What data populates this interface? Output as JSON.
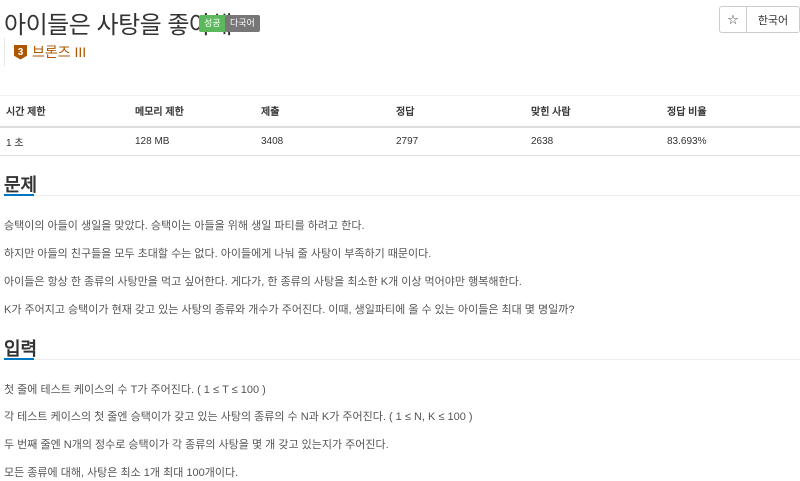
{
  "problem": {
    "title": "아이들은 사탕을 좋아해",
    "badges": [
      "성공",
      "다국어"
    ],
    "tier": {
      "icon_number": "3",
      "label": "브론즈 III",
      "color": "#ad5600"
    }
  },
  "toolbar": {
    "star_icon": "star-icon",
    "star_glyph": "☆",
    "language_label": "한국어"
  },
  "stats": {
    "headers": [
      "시간 제한",
      "메모리 제한",
      "제출",
      "정답",
      "맞힌 사람",
      "정답 비율"
    ],
    "values": [
      "1 초",
      "128 MB",
      "3408",
      "2797",
      "2638",
      "83.693%"
    ]
  },
  "sections": {
    "problem": {
      "heading": "문제",
      "paragraphs": [
        "승택이의 아들이 생일을 맞았다. 승택이는 아들을 위해 생일 파티를 하려고 한다.",
        "하지만 아들의 친구들을 모두 초대할 수는 없다. 아이들에게 나눠 줄 사탕이 부족하기 때문이다.",
        "아이들은 항상 한 종류의 사탕만을 먹고 싶어한다. 게다가, 한 종류의 사탕을 최소한 K개 이상 먹어야만 행복해한다.",
        "K가 주어지고 승택이가 현재 갖고 있는 사탕의 종류와 개수가 주어진다. 이때, 생일파티에 올 수 있는 아이들은 최대 몇 명일까?"
      ]
    },
    "input": {
      "heading": "입력",
      "paragraphs": [
        "첫 줄에 테스트 케이스의 수 T가 주어진다. ( 1 ≤ T ≤ 100 )",
        "각 테스트 케이스의 첫 줄엔 승택이가 갖고 있는 사탕의 종류의 수 N과 K가 주어진다. ( 1 ≤ N, K ≤ 100 )",
        "두 번째 줄엔 N개의 정수로 승택이가 각 종류의 사탕을 몇 개 갖고 있는지가 주어진다.",
        "모든 종류에 대해, 사탕은 최소 1개 최대 100개이다."
      ]
    }
  },
  "colors": {
    "success_badge": "#5cb85c",
    "multilang_badge": "#777777",
    "section_underline": "#0076c0",
    "tier_bronze": "#ad5600"
  }
}
